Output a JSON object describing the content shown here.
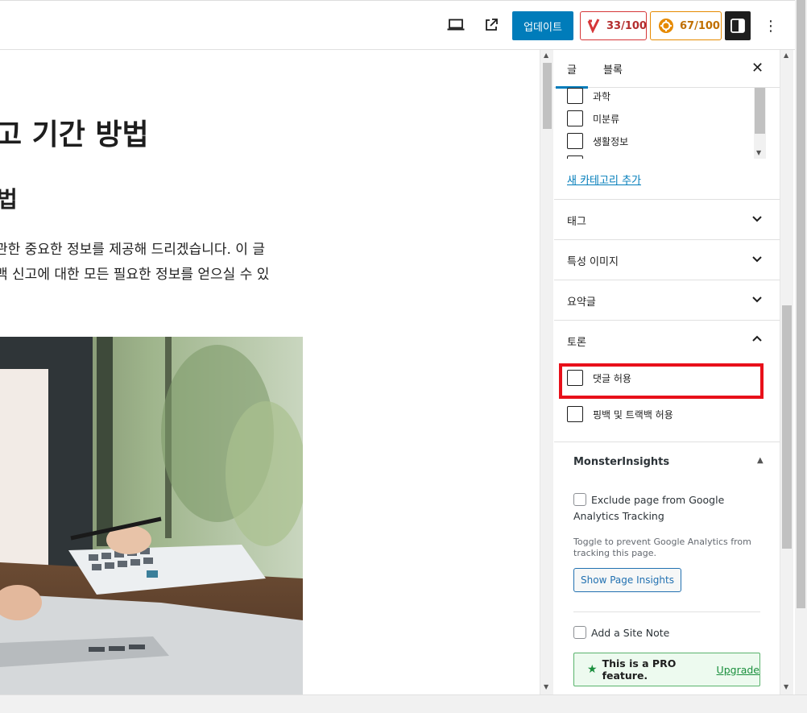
{
  "toolbar": {
    "preview_icon": "laptop-icon",
    "view_post_icon": "external-link-icon",
    "update_label": "업데이트",
    "seo_score": "33/100",
    "readability_score": "67/100",
    "seo_color": "#d63638",
    "readability_color": "#e68a00",
    "settings_icon": "sidebar-toggle-icon",
    "more_icon": "⋮"
  },
  "editor": {
    "heading1": "고 기간 방법",
    "heading2": "법",
    "paragraph_line1": "관한 중요한 정보를 제공해 드리겠습니다. 이 글",
    "paragraph_line2": "백 신고에 대한 모든 필요한 정보를 얻으실 수 있"
  },
  "sidebar": {
    "tabs": [
      {
        "label": "글",
        "active": true
      },
      {
        "label": "블록",
        "active": false
      }
    ],
    "close_icon": "✕",
    "categories": [
      "과학",
      "미분류",
      "생활정보"
    ],
    "add_category": "새 카테고리 추가",
    "panels": [
      {
        "title": "태그",
        "state": "collapsed"
      },
      {
        "title": "특성 이미지",
        "state": "collapsed"
      },
      {
        "title": "요약글",
        "state": "collapsed"
      },
      {
        "title": "토론",
        "state": "expanded"
      }
    ],
    "discussion": {
      "allow_comments": "댓글 허용",
      "allow_pingbacks": "핑백 및 트랙백 허용"
    },
    "monsterinsights": {
      "title": "MonsterInsights",
      "exclude_label": "Exclude page from Google Analytics Tracking",
      "help": "Toggle to prevent Google Analytics from tracking this page.",
      "insights_button": "Show Page Insights",
      "site_note": "Add a Site Note",
      "pro_text": "This is a PRO feature.",
      "upgrade": "Upgrade"
    }
  },
  "colors": {
    "accent": "#007cba",
    "highlight": "#e8101a"
  }
}
